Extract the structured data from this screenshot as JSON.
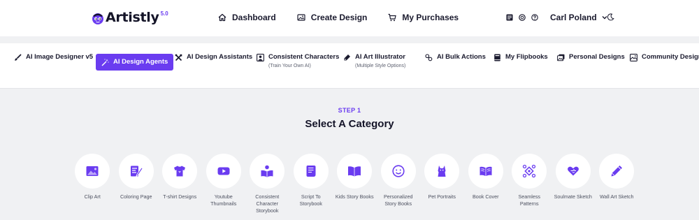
{
  "brand": {
    "name": "Artistly",
    "version": "5.0"
  },
  "colors": {
    "accent": "#6a3cf0",
    "text": "#1a1a2e",
    "background": "#f0f1f3"
  },
  "header": {
    "nav": [
      {
        "label": "Dashboard",
        "icon": "home-icon"
      },
      {
        "label": "Create Design",
        "icon": "image-icon"
      },
      {
        "label": "My Purchases",
        "icon": "cart-icon"
      }
    ],
    "user_name": "Carl Poland"
  },
  "tabs": [
    {
      "label": "AI Image Designer v5",
      "sub": "",
      "icon": "brush-icon"
    },
    {
      "label": "AI Design Agents",
      "sub": "",
      "icon": "magic-wand-icon",
      "active": true
    },
    {
      "label": "AI Design Assistants",
      "sub": "",
      "icon": "tools-icon"
    },
    {
      "label": "Consistent Characters",
      "sub": "(Train Your Own AI)",
      "icon": "portrait-icon"
    },
    {
      "label": "AI Art Illustrator",
      "sub": "(Multiple Style Options)",
      "icon": "palette-icon"
    },
    {
      "label": "AI Bulk Actions",
      "sub": "",
      "icon": "bulk-icon"
    },
    {
      "label": "My Flipbooks",
      "sub": "",
      "icon": "book-icon"
    },
    {
      "label": "Personal Designs",
      "sub": "",
      "icon": "images-icon"
    },
    {
      "label": "Community Designs",
      "sub": "",
      "icon": "gallery-icon"
    }
  ],
  "step": {
    "label": "STEP 1",
    "title": "Select A Category"
  },
  "categories": [
    {
      "label": "Clip Art",
      "icon": "picture-icon"
    },
    {
      "label": "Coloring Page",
      "icon": "coloring-icon"
    },
    {
      "label": "T-shirt Designs",
      "icon": "tshirt-icon"
    },
    {
      "label": "Youtube Thumbnails",
      "icon": "youtube-icon"
    },
    {
      "label": "Consistent Character Storybook",
      "icon": "reader-icon"
    },
    {
      "label": "Script To Storybook",
      "icon": "scroll-icon"
    },
    {
      "label": "Kids Story Books",
      "icon": "open-book-icon"
    },
    {
      "label": "Personalized Story Books",
      "icon": "smiley-icon"
    },
    {
      "label": "Pet Portraits",
      "icon": "cat-icon"
    },
    {
      "label": "Book Cover",
      "icon": "book-cover-icon"
    },
    {
      "label": "Seamless Patterns",
      "icon": "pattern-icon"
    },
    {
      "label": "Soulmate Sketch",
      "icon": "heart-hand-icon"
    },
    {
      "label": "Wall Art Sketch",
      "icon": "pencil-icon"
    }
  ]
}
